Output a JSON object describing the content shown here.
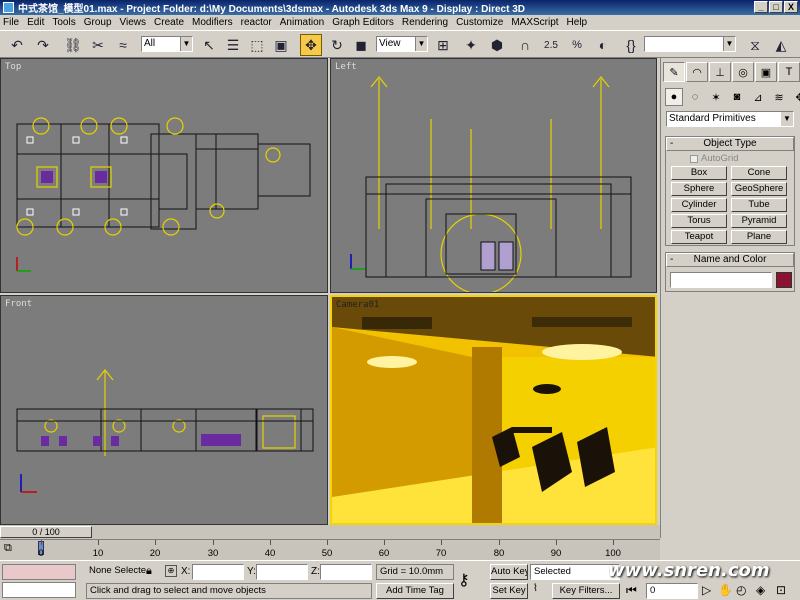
{
  "window": {
    "title": "中式茶馆_模型01.max    - Project Folder: d:\\My Documents\\3dsmax    - Autodesk 3ds Max 9    - Display : Direct 3D",
    "minimize": "_",
    "maximize": "□",
    "close": "X"
  },
  "menu": [
    "File",
    "Edit",
    "Tools",
    "Group",
    "Views",
    "Create",
    "Modifiers",
    "reactor",
    "Animation",
    "Graph Editors",
    "Rendering",
    "Customize",
    "MAXScript",
    "Help"
  ],
  "toolbar": {
    "selection_filter": "All",
    "ref_coord": "View",
    "named_selection": "",
    "snap_angle_label": "2.5",
    "snap_percent_label": "%"
  },
  "viewports": {
    "top": "Top",
    "left": "Left",
    "front": "Front",
    "camera": "Camera01"
  },
  "command_panel": {
    "category": "Standard Primitives",
    "object_type_title": "Object Type",
    "autogrid": "AutoGrid",
    "buttons": [
      "Box",
      "Cone",
      "Sphere",
      "GeoSphere",
      "Cylinder",
      "Tube",
      "Torus",
      "Pyramid",
      "Teapot",
      "Plane"
    ],
    "name_color_title": "Name and Color",
    "object_color": "#8b1230"
  },
  "timeline": {
    "frame_display": "0 / 100",
    "ticks": [
      "0",
      "10",
      "20",
      "30",
      "40",
      "50",
      "60",
      "70",
      "80",
      "90",
      "100"
    ]
  },
  "status": {
    "selection": "None Selecte",
    "x_label": "X:",
    "y_label": "Y:",
    "z_label": "Z:",
    "grid": "Grid = 10.0mm",
    "prompt": "Click and drag to select and move objects",
    "add_time_tag": "Add Time Tag",
    "auto_key": "Auto Key",
    "set_key": "Set Key",
    "selected_dropdown": "Selected",
    "key_filters": "Key Filters...",
    "frame_field": "0"
  },
  "watermark": "www.snren.com"
}
